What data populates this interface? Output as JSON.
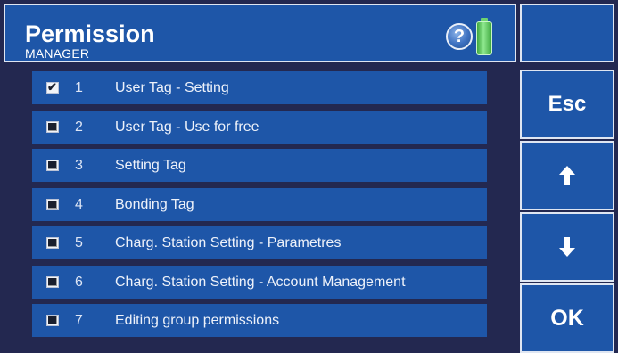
{
  "header": {
    "title": "Permission",
    "subtitle": "MANAGER",
    "help_symbol": "?",
    "icons": [
      "help-icon",
      "battery-icon"
    ]
  },
  "sidebar": {
    "esc_label": "Esc",
    "up_icon": "arrow-up-icon",
    "down_icon": "arrow-down-icon",
    "ok_label": "OK"
  },
  "permissions": [
    {
      "num": "1",
      "label": "User Tag - Setting",
      "checked": true
    },
    {
      "num": "2",
      "label": "User Tag - Use for free",
      "checked": false
    },
    {
      "num": "3",
      "label": "Setting Tag",
      "checked": false
    },
    {
      "num": "4",
      "label": "Bonding Tag",
      "checked": false
    },
    {
      "num": "5",
      "label": "Charg. Station Setting - Parametres",
      "checked": false
    },
    {
      "num": "6",
      "label": "Charg. Station Setting - Account Management",
      "checked": false
    },
    {
      "num": "7",
      "label": "Editing group permissions",
      "checked": false
    }
  ],
  "colors": {
    "panel_blue": "#1e56a8",
    "background": "#232850",
    "border": "#dfe6f2",
    "battery_green": "#5fcf5f"
  }
}
